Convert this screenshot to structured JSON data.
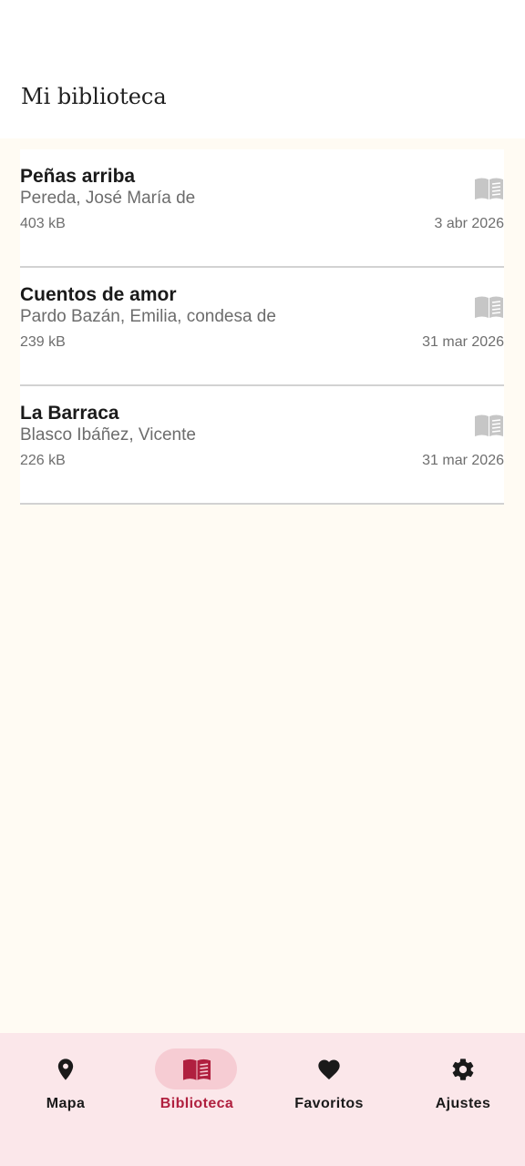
{
  "header": {
    "title": "Mi biblioteca"
  },
  "books": [
    {
      "title": "Peñas arriba",
      "author": "Pereda, José María de",
      "size": "403 kB",
      "date": "3 abr 2026",
      "icon": "book-open-icon"
    },
    {
      "title": "Cuentos de amor",
      "author": "Pardo Bazán, Emilia, condesa de",
      "size": "239 kB",
      "date": "31 mar 2026",
      "icon": "book-open-icon"
    },
    {
      "title": "La Barraca",
      "author": "Blasco Ibáñez, Vicente",
      "size": "226 kB",
      "date": "31 mar 2026",
      "icon": "book-open-icon"
    }
  ],
  "bottom_nav": {
    "items": [
      {
        "label": "Mapa",
        "icon": "map-pin-icon",
        "active": false
      },
      {
        "label": "Biblioteca",
        "icon": "book-open-icon",
        "active": true
      },
      {
        "label": "Favoritos",
        "icon": "heart-icon",
        "active": false
      },
      {
        "label": "Ajustes",
        "icon": "gear-icon",
        "active": false
      }
    ]
  },
  "colors": {
    "accent": "#b0203f",
    "active_indicator": "#f6ccd3",
    "nav_background": "#fbe7ea",
    "page_background": "#fffbf3"
  }
}
